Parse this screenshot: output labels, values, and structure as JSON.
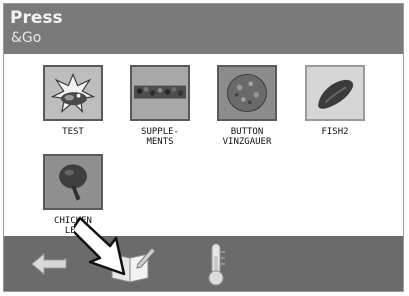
{
  "app": {
    "title_main": "Press",
    "title_sub": "&Go"
  },
  "recipes": [
    {
      "label": "TEST",
      "icon": "test-recipe-icon"
    },
    {
      "label": "SUPPLE-\nMENTS",
      "icon": "supplements-recipe-icon"
    },
    {
      "label": "BUTTON\nVINZGAUER",
      "icon": "button-vinzgauer-recipe-icon"
    },
    {
      "label": "FISH2",
      "icon": "fish-recipe-icon"
    },
    {
      "label": "CHICKEN\nLEG",
      "icon": "chicken-leg-recipe-icon"
    }
  ],
  "toolbar": {
    "back": {
      "icon": "back-arrow-icon"
    },
    "recipe_book": {
      "icon": "recipe-book-edit-icon"
    },
    "temperature": {
      "icon": "thermometer-icon"
    }
  },
  "overlay": {
    "icon": "pointing-arrow-icon"
  },
  "colors": {
    "header": "#7a7a7a",
    "toolbar": "#6b6b6b",
    "thumb_border": "#5a5a5a"
  }
}
